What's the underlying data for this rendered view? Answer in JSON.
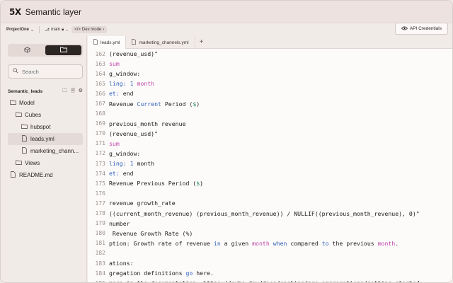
{
  "app": {
    "logo": "5X",
    "title": "Semantic layer"
  },
  "toolbar": {
    "project": "ProjectOne",
    "branch": "main",
    "devmode": "Dev mode",
    "api_button": "API Credentials"
  },
  "sidebar": {
    "search_placeholder": "Search",
    "section_title": "Semantic_leads",
    "tree": [
      {
        "label": "Model",
        "indent": 0,
        "type": "folder"
      },
      {
        "label": "Cubes",
        "indent": 1,
        "type": "folder"
      },
      {
        "label": "hubspot",
        "indent": 2,
        "type": "folder"
      },
      {
        "label": "leads.yml",
        "indent": 2,
        "type": "file",
        "selected": true
      },
      {
        "label": "marketing_chann...",
        "indent": 2,
        "type": "file"
      },
      {
        "label": "Views",
        "indent": 1,
        "type": "folder"
      },
      {
        "label": "README.md",
        "indent": 0,
        "type": "file"
      }
    ]
  },
  "editor": {
    "tabs": [
      {
        "label": "leads.yml",
        "active": true
      },
      {
        "label": "marketing_channels.yml",
        "active": false
      }
    ],
    "lines": [
      {
        "n": "162",
        "segs": [
          [
            "(revenue_usd)\"",
            ""
          ]
        ]
      },
      {
        "n": "163",
        "segs": [
          [
            "sum",
            "pink"
          ]
        ]
      },
      {
        "n": "164",
        "segs": [
          [
            "g_window:",
            ""
          ]
        ]
      },
      {
        "n": "165",
        "segs": [
          [
            "ling: ",
            "blue"
          ],
          [
            "1",
            "blue"
          ],
          [
            " month",
            "pink"
          ]
        ]
      },
      {
        "n": "166",
        "segs": [
          [
            "et:",
            "blue"
          ],
          [
            " end",
            ""
          ]
        ]
      },
      {
        "n": "167",
        "segs": [
          [
            "Revenue ",
            ""
          ],
          [
            "Current",
            "blue"
          ],
          [
            " Period (",
            ""
          ],
          [
            "$",
            "green"
          ],
          [
            ")",
            ""
          ]
        ]
      },
      {
        "n": "168",
        "segs": [
          [
            "",
            ""
          ]
        ]
      },
      {
        "n": "169",
        "segs": [
          [
            "previous_month revenue",
            ""
          ]
        ]
      },
      {
        "n": "170",
        "segs": [
          [
            "(revenue_usd)\"",
            ""
          ]
        ]
      },
      {
        "n": "171",
        "segs": [
          [
            "sum",
            "pink"
          ]
        ]
      },
      {
        "n": "172",
        "segs": [
          [
            "g_window:",
            ""
          ]
        ]
      },
      {
        "n": "173",
        "segs": [
          [
            "ling: ",
            "blue"
          ],
          [
            "1",
            "blue"
          ],
          [
            " month",
            ""
          ]
        ]
      },
      {
        "n": "174",
        "segs": [
          [
            "et:",
            "blue"
          ],
          [
            " end",
            ""
          ]
        ]
      },
      {
        "n": "175",
        "segs": [
          [
            "Revenue Previous Period (",
            ""
          ],
          [
            "$",
            "green"
          ],
          [
            ")",
            ""
          ]
        ]
      },
      {
        "n": "176",
        "segs": [
          [
            "",
            ""
          ]
        ]
      },
      {
        "n": "177",
        "segs": [
          [
            "revenue growth_rate",
            ""
          ]
        ]
      },
      {
        "n": "178",
        "segs": [
          [
            "((current_month_revenue) (previous_month_revenue)) / NULLIF((previous_month_revenue), 0)\"",
            ""
          ]
        ]
      },
      {
        "n": "179",
        "segs": [
          [
            "number",
            ""
          ]
        ]
      },
      {
        "n": "180",
        "segs": [
          [
            " Revenue Growth Rate (%)",
            ""
          ]
        ]
      },
      {
        "n": "181",
        "segs": [
          [
            "ption: Growth rate of revenue ",
            ""
          ],
          [
            "in",
            "blue"
          ],
          [
            " a given ",
            ""
          ],
          [
            "month",
            "pink"
          ],
          [
            " ",
            ""
          ],
          [
            "when",
            "blue"
          ],
          [
            " compared ",
            ""
          ],
          [
            "to",
            "blue"
          ],
          [
            " the previous ",
            ""
          ],
          [
            "month",
            "pink"
          ],
          [
            ".",
            ""
          ]
        ]
      },
      {
        "n": "182",
        "segs": [
          [
            "",
            ""
          ]
        ]
      },
      {
        "n": "183",
        "segs": [
          [
            "ations:",
            ""
          ]
        ]
      },
      {
        "n": "184",
        "segs": [
          [
            "gregation definitions ",
            ""
          ],
          [
            "go",
            "blue"
          ],
          [
            " here.",
            ""
          ]
        ]
      },
      {
        "n": "185",
        "segs": [
          [
            "more in the documentation: https://cube.dev/docs/caching/pre-aggregations/getting-started",
            ""
          ]
        ]
      }
    ]
  },
  "colors": {
    "blue": "#2f5fb8",
    "pink": "#c044a8",
    "green": "#2b8a6a"
  }
}
